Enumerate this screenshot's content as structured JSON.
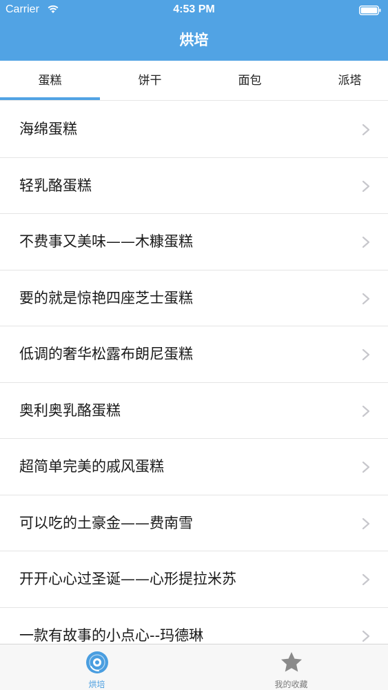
{
  "status_bar": {
    "carrier": "Carrier",
    "time": "4:53 PM",
    "icons": [
      "wifi-icon",
      "battery-icon"
    ]
  },
  "nav": {
    "title": "烘培"
  },
  "tabs": [
    {
      "label": "蛋糕",
      "selected": true
    },
    {
      "label": "饼干",
      "selected": false
    },
    {
      "label": "面包",
      "selected": false
    },
    {
      "label": "派塔",
      "selected": false
    }
  ],
  "list": {
    "items": [
      {
        "label": "海绵蛋糕"
      },
      {
        "label": "轻乳酪蛋糕"
      },
      {
        "label": "不费事又美味——木糠蛋糕"
      },
      {
        "label": "要的就是惊艳四座芝士蛋糕"
      },
      {
        "label": "低调的奢华松露布朗尼蛋糕"
      },
      {
        "label": "奥利奥乳酪蛋糕"
      },
      {
        "label": "超简单完美的戚风蛋糕"
      },
      {
        "label": "可以吃的土豪金——费南雪"
      },
      {
        "label": "开开心心过圣诞——心形提拉米苏"
      },
      {
        "label": "一款有故事的小点心--玛德琳"
      }
    ]
  },
  "tabbar": {
    "items": [
      {
        "label": "烘培",
        "icon": "disc-icon",
        "selected": true
      },
      {
        "label": "我的收藏",
        "icon": "star-icon",
        "selected": false
      }
    ]
  },
  "colors": {
    "accent": "#51a3e4",
    "tab_selected_text": "#4a9ee0",
    "tab_unselected_text": "#7a7a7a",
    "chevron": "#c7c7cc"
  }
}
